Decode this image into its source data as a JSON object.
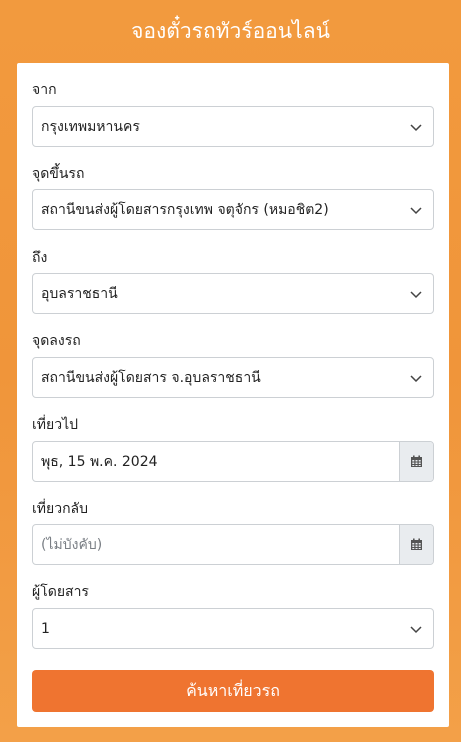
{
  "header": {
    "title": "จองตั๋วรถทัวร์ออนไลน์"
  },
  "form": {
    "from": {
      "label": "จาก",
      "value": "กรุงเทพมหานคร"
    },
    "boarding": {
      "label": "จุดขึ้นรถ",
      "value": "สถานีขนส่งผู้โดยสารกรุงเทพ จตุจักร (หมอชิต2)"
    },
    "to": {
      "label": "ถึง",
      "value": "อุบลราชธานี"
    },
    "dropoff": {
      "label": "จุดลงรถ",
      "value": "สถานีขนส่งผู้โดยสาร จ.อุบลราชธานี"
    },
    "depart": {
      "label": "เที่ยวไป",
      "value": "พุธ, 15 พ.ค. 2024"
    },
    "return": {
      "label": "เที่ยวกลับ",
      "placeholder": "(ไม่บังคับ)"
    },
    "passengers": {
      "label": "ผู้โดยสาร",
      "value": "1"
    },
    "search_button": "ค้นหาเที่ยวรถ"
  },
  "icons": {
    "dropdown": "chevron-down-icon",
    "calendar": "calendar-icon"
  },
  "colors": {
    "background": "#f29a3e",
    "button": "#ef7430",
    "addon": "#e9ecef"
  }
}
